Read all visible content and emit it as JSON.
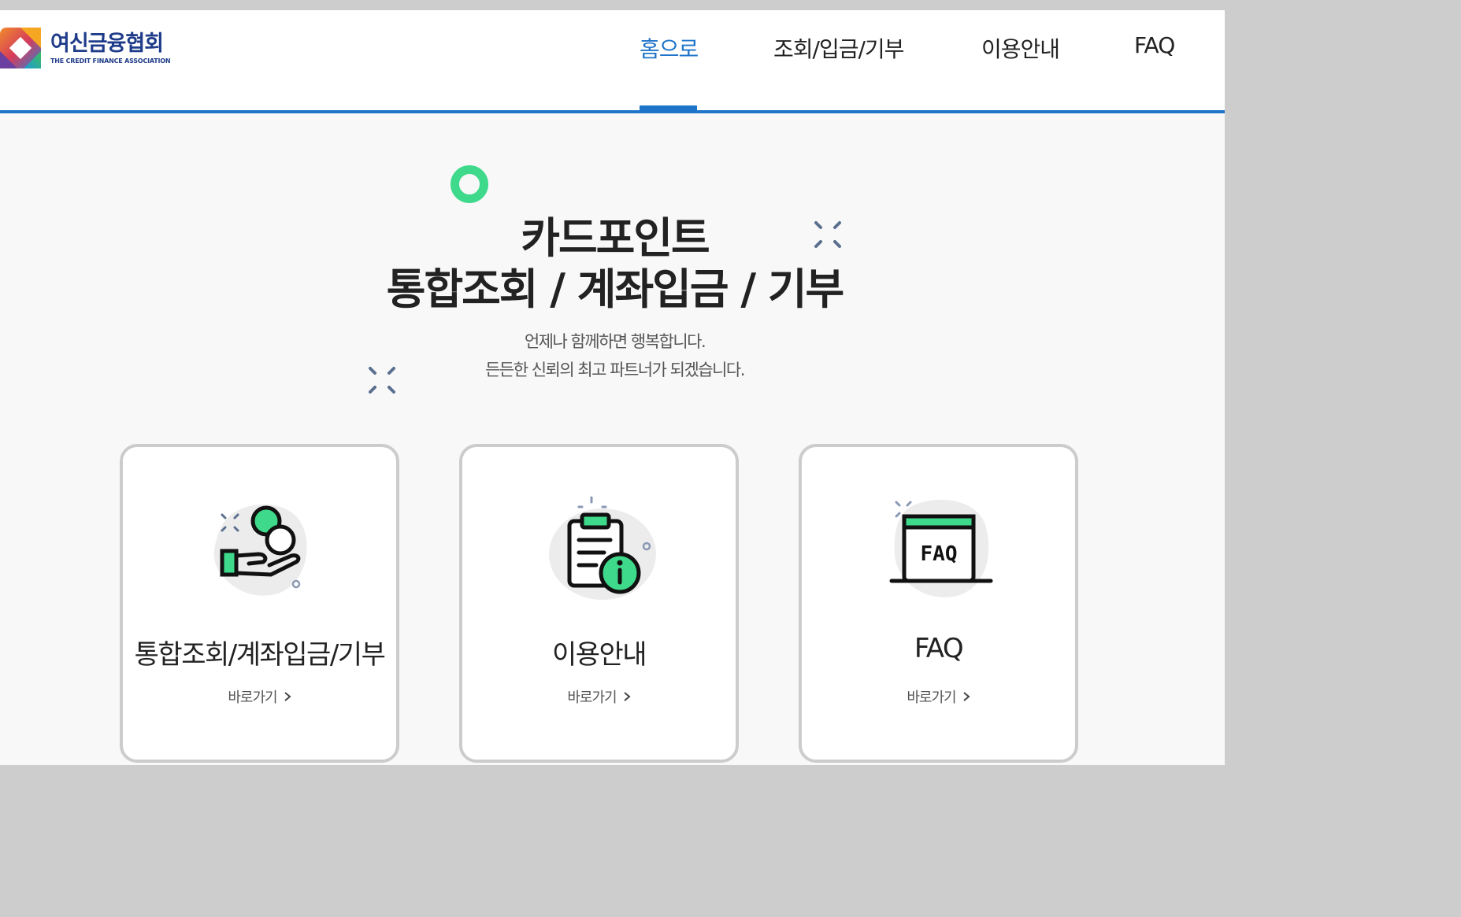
{
  "brand": {
    "name_ko": "여신금융협회",
    "name_en": "THE CREDIT FINANCE ASSOCIATION",
    "accent": "#1e74c9",
    "green": "#3ed98a"
  },
  "nav": {
    "items": [
      {
        "label": "홈으로",
        "active": true
      },
      {
        "label": "조회/입금/기부",
        "active": false
      },
      {
        "label": "이용안내",
        "active": false
      },
      {
        "label": "FAQ",
        "active": false
      }
    ]
  },
  "hero": {
    "title_line1": "카드포인트",
    "title_line2": "통합조회 / 계좌입금 / 기부",
    "sub_line1": "언제나 함께하면 행복합니다.",
    "sub_line2": "든든한 신뢰의 최고 파트너가 되겠습니다."
  },
  "cards": [
    {
      "title": "통합조회/계좌입금/기부",
      "link": "바로가기",
      "icon": "coin-hand-icon"
    },
    {
      "title": "이용안내",
      "link": "바로가기",
      "icon": "clipboard-info-icon"
    },
    {
      "title": "FAQ",
      "link": "바로가기",
      "icon": "faq-board-icon",
      "icon_text": "FAQ"
    }
  ]
}
